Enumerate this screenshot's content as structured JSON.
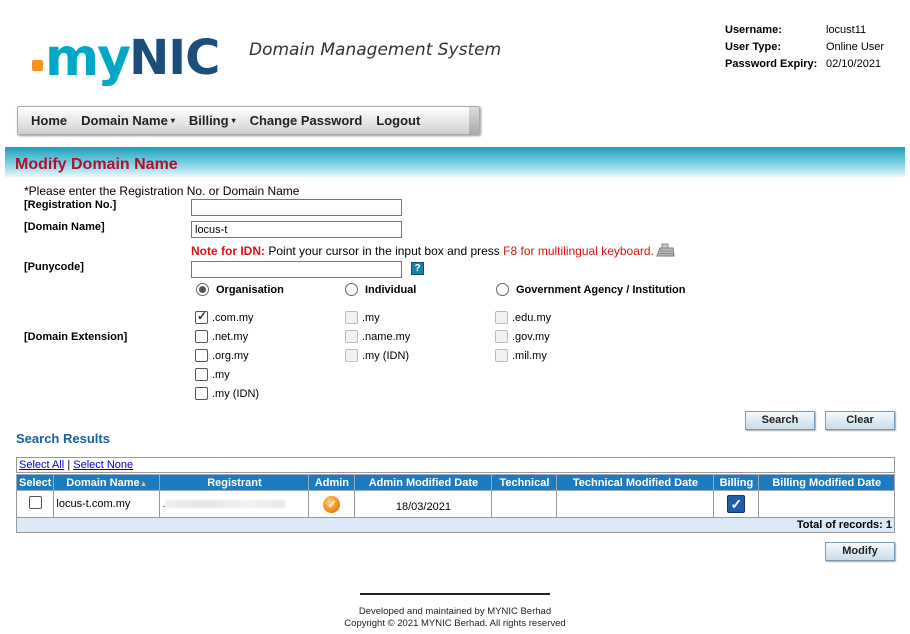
{
  "brand": {
    "my": "my",
    "nic": "NIC",
    "subtitle": "Domain Management System"
  },
  "user": {
    "username_label": "Username:",
    "username": "locust11",
    "usertype_label": "User Type:",
    "usertype": "Online User",
    "expiry_label": "Password Expiry:",
    "expiry": "02/10/2021"
  },
  "menu": {
    "home": "Home",
    "domain_name": "Domain Name",
    "billing": "Billing",
    "change_password": "Change Password",
    "logout": "Logout"
  },
  "page_title": "Modify Domain Name",
  "form": {
    "instruction": "*Please enter the Registration No. or Domain Name",
    "reg_label": "[Registration No.]",
    "reg_value": "",
    "domain_label": "[Domain Name]",
    "domain_value": "locus-t",
    "idn_note_label": "Note for IDN:",
    "idn_note_mid": "Point your cursor in the input box and press",
    "idn_note_end": "F8 for multilingual keyboard.",
    "puny_label": "[Punycode]",
    "puny_value": "",
    "help_icon": "?",
    "types": {
      "organisation": "Organisation",
      "individual": "Individual",
      "government": "Government Agency / Institution",
      "selected": "Organisation"
    },
    "ext_label": "[Domain Extension]",
    "ext_org": [
      {
        "label": ".com.my",
        "checked": true
      },
      {
        "label": ".net.my",
        "checked": false
      },
      {
        "label": ".org.my",
        "checked": false
      },
      {
        "label": ".my",
        "checked": false
      },
      {
        "label": ".my (IDN)",
        "checked": false
      }
    ],
    "ext_ind": [
      {
        "label": ".my",
        "disabled": true
      },
      {
        "label": ".name.my",
        "disabled": true
      },
      {
        "label": ".my (IDN)",
        "disabled": true
      }
    ],
    "ext_gov": [
      {
        "label": ".edu.my",
        "disabled": true
      },
      {
        "label": ".gov.my",
        "disabled": true
      },
      {
        "label": ".mil.my",
        "disabled": true
      }
    ],
    "search_button": "Search",
    "clear_button": "Clear"
  },
  "results": {
    "title": "Search Results",
    "select_all": "Select All",
    "separator": "|",
    "select_none": "Select None",
    "columns": [
      "Select",
      "Domain Name",
      "Registrant",
      "Admin",
      "Admin Modified Date",
      "Technical",
      "Technical Modified Date",
      "Billing",
      "Billing Modified Date"
    ],
    "sort_marker": "▲",
    "rows": [
      {
        "domain": "locus-t.com.my",
        "registrant": ".",
        "admin_date": "18/03/2021",
        "technical": "",
        "technical_date": "",
        "billing_date": ""
      }
    ],
    "total": "Total of records: 1",
    "modify_button": "Modify"
  },
  "footer": {
    "line1": "Developed and maintained by MYNIC Berhad",
    "line2": "Copyright © 2021 MYNIC Berhad. All rights reserved"
  },
  "colors": {
    "title_red": "#b0112a",
    "band": "#1d9fbd",
    "table_header": "#1d7bbf",
    "link_blue": "#1a5fa8"
  }
}
